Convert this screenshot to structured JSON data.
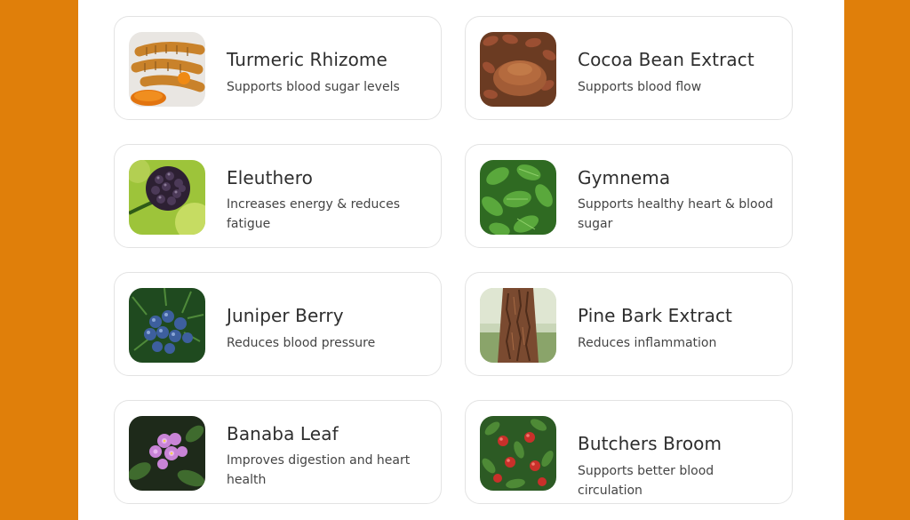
{
  "ingredients": [
    {
      "name": "Turmeric Rhizome",
      "description": "Supports blood sugar levels",
      "icon": "turmeric-image",
      "color": "#d8871f"
    },
    {
      "name": "Cocoa Bean Extract",
      "description": "Supports blood flow",
      "icon": "cocoa-bean-image",
      "color": "#8a4b2c"
    },
    {
      "name": "Eleuthero",
      "description": "Increases energy & reduces fatigue",
      "icon": "eleuthero-berries-image",
      "color": "#3b2946"
    },
    {
      "name": "Gymnema",
      "description": "Supports healthy heart & blood sugar",
      "icon": "gymnema-leaves-image",
      "color": "#3f8f2f"
    },
    {
      "name": "Juniper Berry",
      "description": "Reduces blood pressure",
      "icon": "juniper-berries-image",
      "color": "#2c4a86"
    },
    {
      "name": "Pine Bark Extract",
      "description": "Reduces inflammation",
      "icon": "pine-bark-image",
      "color": "#7a4a30"
    },
    {
      "name": "Banaba Leaf",
      "description": "Improves digestion and heart health",
      "icon": "banaba-flower-image",
      "color": "#c06bc4"
    },
    {
      "name": "Butchers Broom",
      "description": "Supports better blood circulation",
      "icon": "butchers-broom-image",
      "color": "#c0302a"
    }
  ]
}
